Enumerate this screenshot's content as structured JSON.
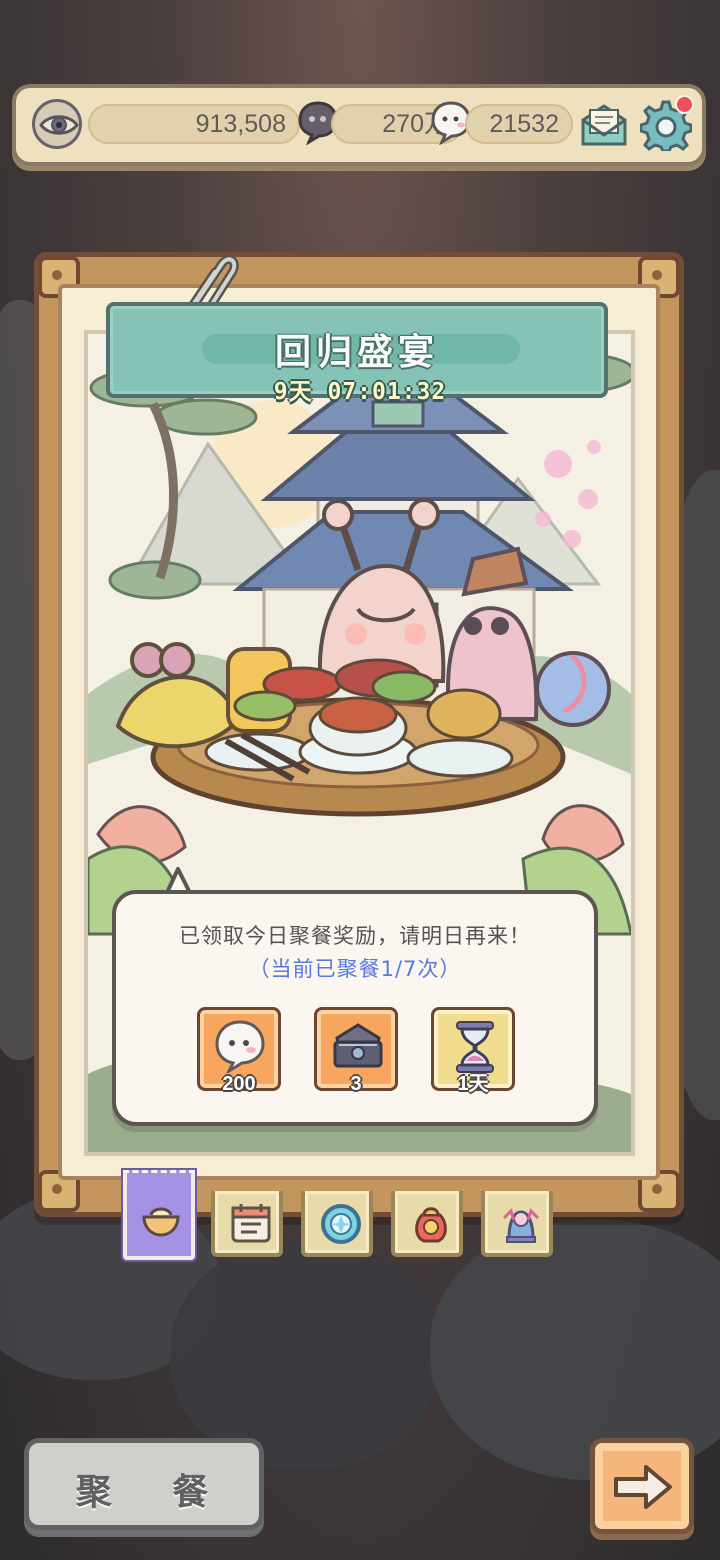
{
  "top_bar": {
    "eye_value": "913,508",
    "currency_a": "270万",
    "currency_b": "21532"
  },
  "event": {
    "title": "回归盛宴",
    "countdown": "9天 07:01:32"
  },
  "reward_panel": {
    "message": "已领取今日聚餐奖励，请明日再来！",
    "status": "（当前已聚餐1/7次）",
    "items": [
      {
        "quantity": "200",
        "icon": "ghost-bubble-icon"
      },
      {
        "quantity": "3",
        "icon": "treasure-chest-icon"
      },
      {
        "quantity": "1天",
        "icon": "hourglass-icon"
      }
    ]
  },
  "tabs": [
    {
      "icon": "feast-bowl-icon",
      "active": true
    },
    {
      "icon": "calendar-icon",
      "active": false
    },
    {
      "icon": "blue-coin-icon",
      "active": false
    },
    {
      "icon": "lucky-bag-icon",
      "active": false
    },
    {
      "icon": "statue-icon",
      "active": false
    }
  ],
  "actions": {
    "gather_label": "聚 餐",
    "next_icon": "right-arrow-icon"
  },
  "colors": {
    "accent_blue": "#5877e0",
    "title_teal": "#85c3b6",
    "active_tab": "#a592e3",
    "reward_orange": "#f7a660"
  }
}
